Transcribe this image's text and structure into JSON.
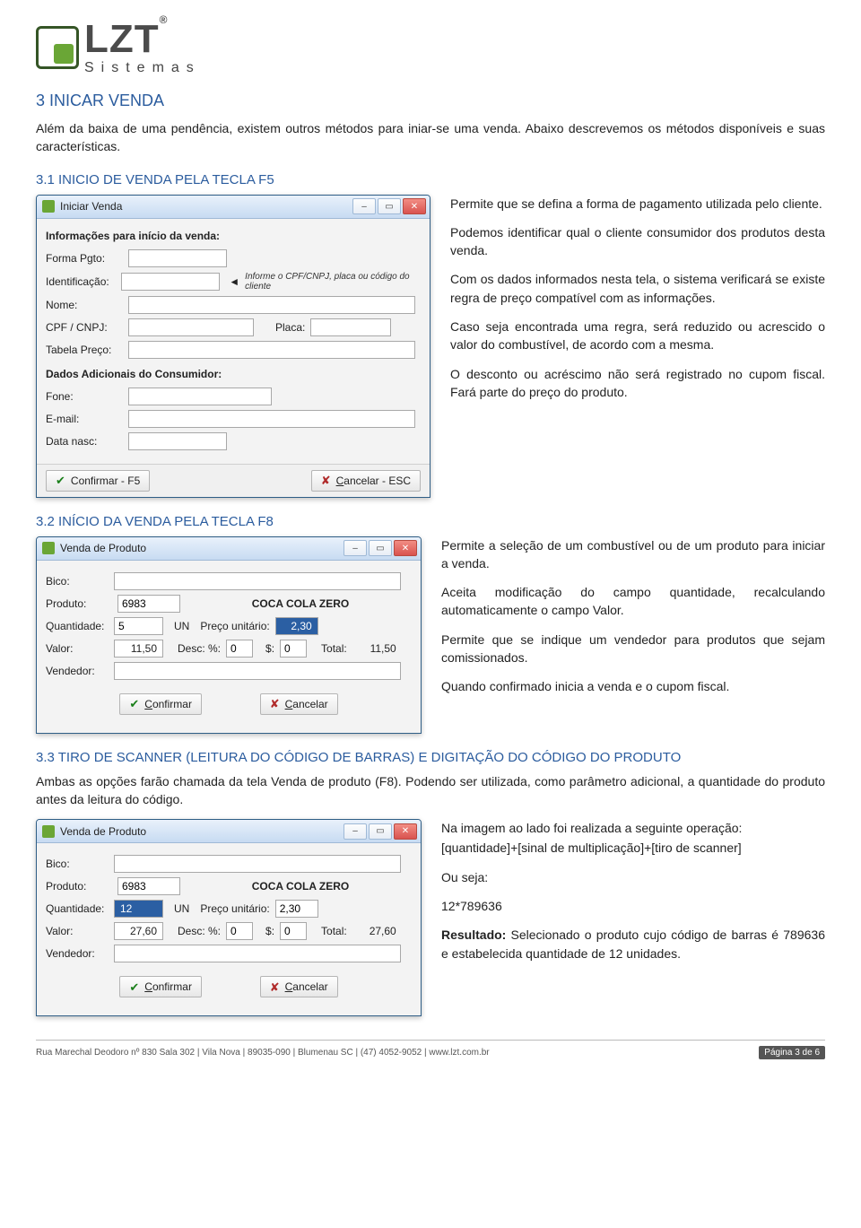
{
  "logo": {
    "brand": "LZT",
    "sub": "Sistemas",
    "reg": "®"
  },
  "h1": "3   INICAR VENDA",
  "intro": "Além da baixa de uma pendência, existem outros métodos para iniar-se uma venda. Abaixo descrevemos os métodos disponíveis e suas características.",
  "h2a": "3.1   INICIO DE VENDA PELA TECLA F5",
  "dlg1": {
    "title": "Iniciar Venda",
    "section1": "Informações para início da venda:",
    "labels": {
      "forma": "Forma Pgto:",
      "ident": "Identificação:",
      "ident_hint": "Informe o CPF/CNPJ, placa ou código do cliente",
      "nome": "Nome:",
      "cpf": "CPF / CNPJ:",
      "placa": "Placa:",
      "tabela": "Tabela Preço:",
      "section2": "Dados Adicionais do Consumidor:",
      "fone": "Fone:",
      "email": "E-mail:",
      "datan": "Data nasc:"
    },
    "btn_confirm": "Confirmar - F5",
    "btn_cancel": "Cancelar - ESC"
  },
  "explain1": {
    "p1": "Permite que se defina a forma de pagamento utilizada pelo cliente.",
    "p2": "Podemos identificar qual o cliente consumidor dos produtos desta venda.",
    "p3": "Com os dados informados nesta tela, o sistema verificará se existe regra de preço compatível com as informações.",
    "p4": "Caso seja encontrada uma regra, será reduzido ou acrescido o valor do combustível, de acordo com a mesma.",
    "p5": "O desconto ou acréscimo não será registrado no cupom fiscal. Fará parte do preço do produto."
  },
  "h2b": "3.2   INÍCIO DA VENDA PELA TECLA F8",
  "dlg2": {
    "title": "Venda de Produto",
    "labels": {
      "bico": "Bico:",
      "produto": "Produto:",
      "qtd": "Quantidade:",
      "un": "UN",
      "preco": "Preço unitário:",
      "valor": "Valor:",
      "descp": "Desc:  %:",
      "descv": "$:",
      "total": "Total:",
      "vendedor": "Vendedor:"
    },
    "values": {
      "produto_cod": "6983",
      "produto_nome": "COCA COLA ZERO",
      "qtd": "5",
      "preco": "2,30",
      "valor": "11,50",
      "descp": "0",
      "descv": "0",
      "total": "11,50"
    },
    "btn_confirm": "Confirmar",
    "btn_cancel": "Cancelar"
  },
  "explain2": {
    "p1": "Permite a seleção de um combustível ou de um produto para iniciar a venda.",
    "p2": "Aceita modificação do campo quantidade, recalculando automaticamente o campo Valor.",
    "p3": "Permite que se indique um vendedor para produtos que sejam comissionados.",
    "p4": "Quando confirmado inicia a venda e o cupom fiscal."
  },
  "h2c": "3.3   TIRO DE SCANNER (LEITURA DO CÓDIGO DE BARRAS) E DIGITAÇÃO DO CÓDIGO DO PRODUTO",
  "p33": "Ambas as opções farão chamada da tela Venda de produto (F8). Podendo ser utilizada, como parâmetro adicional, a quantidade do produto antes da leitura do código.",
  "dlg3": {
    "title": "Venda de Produto",
    "values": {
      "produto_cod": "6983",
      "produto_nome": "COCA COLA ZERO",
      "qtd": "12",
      "preco": "2,30",
      "valor": "27,60",
      "descp": "0",
      "descv": "0",
      "total": "27,60"
    }
  },
  "explain3": {
    "p1": "Na imagem ao lado foi realizada a seguinte operação:",
    "p2": "[quantidade]+[sinal de multiplicação]+[tiro de scanner]",
    "p3": "Ou seja:",
    "p4": "12*789636",
    "res_label": "Resultado:",
    "p5": " Selecionado o produto cujo código de barras é 789636 e estabelecida quantidade de 12 unidades."
  },
  "footer": {
    "addr": "Rua Marechal Deodoro nº 830 Sala 302   |   Vila Nova   |   89035-090   |   Blumenau SC   |   (47) 4052-9052   |   www.lzt.com.br",
    "page": "Página  3 de 6"
  }
}
